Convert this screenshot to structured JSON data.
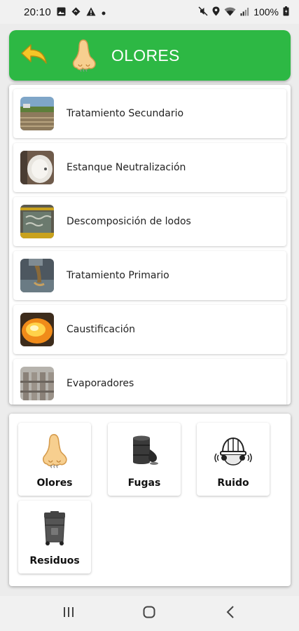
{
  "status_bar": {
    "time": "20:10",
    "battery": "100%",
    "left_icons": [
      "image-icon",
      "location-diamond-icon",
      "warning-icon",
      "dot-icon"
    ],
    "right_icons": [
      "mute-icon",
      "location-pin-icon",
      "wifi-icon",
      "signal-icon",
      "battery-icon"
    ]
  },
  "header": {
    "title": "OLORES",
    "back_icon": "back-arrow-icon",
    "category_icon": "nose-icon",
    "color": "#2db844"
  },
  "areas": [
    {
      "label": "Tratamiento Secundario",
      "thumb": "secondary-treatment-photo"
    },
    {
      "label": "Estanque Neutralización",
      "thumb": "neutralization-tank-photo"
    },
    {
      "label": "Descomposición de lodos",
      "thumb": "sludge-decomposition-photo"
    },
    {
      "label": "Tratamiento Primario",
      "thumb": "primary-treatment-photo"
    },
    {
      "label": "Caustificación",
      "thumb": "caustification-photo"
    },
    {
      "label": "Evaporadores",
      "thumb": "evaporators-photo"
    }
  ],
  "categories": [
    {
      "label": "Olores",
      "icon": "nose-icon"
    },
    {
      "label": "Fugas",
      "icon": "barrel-leak-icon"
    },
    {
      "label": "Ruido",
      "icon": "helmet-noise-icon"
    },
    {
      "label": "Residuos",
      "icon": "trash-bin-icon"
    }
  ],
  "nav": {
    "icons": [
      "recent-apps-icon",
      "home-icon",
      "back-icon"
    ]
  }
}
